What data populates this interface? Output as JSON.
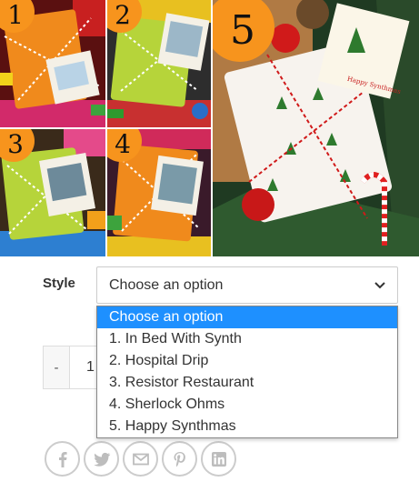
{
  "gallery": {
    "badges": [
      "1",
      "2",
      "3",
      "4",
      "5"
    ],
    "card_text": "Happy Synthmas"
  },
  "variation": {
    "label": "Style",
    "selected": "Choose an option",
    "options": [
      "Choose an option",
      "1. In Bed With Synth",
      "2. Hospital Drip",
      "3. Resistor Restaurant",
      "4. Sherlock Ohms",
      "5. Happy Synthmas"
    ],
    "highlighted_index": 0
  },
  "quantity": {
    "minus_label": "-",
    "value": "1"
  },
  "social": [
    "facebook-icon",
    "twitter-icon",
    "email-icon",
    "pinterest-icon",
    "linkedin-icon"
  ],
  "colors": {
    "badge": "#f7941d",
    "highlight": "#1e90ff",
    "icon_grey": "#bdbdbd"
  }
}
